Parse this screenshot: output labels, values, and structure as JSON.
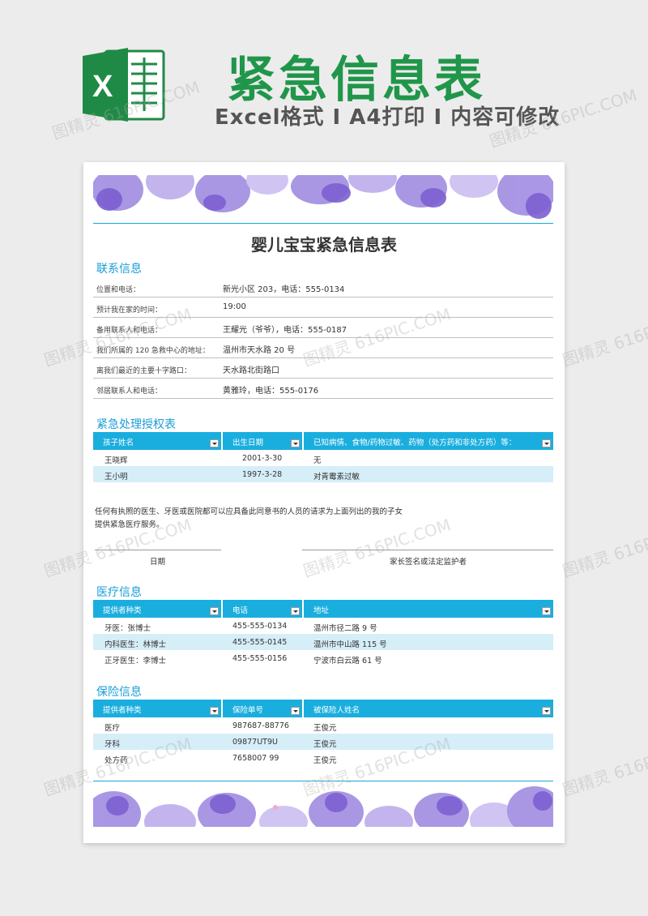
{
  "header": {
    "logo_letter": "X",
    "title": "紧急信息表",
    "subtitle": "Excel格式 I A4打印 I 内容可修改"
  },
  "watermark": "图精灵 616PIC.COM",
  "document": {
    "title": "婴儿宝宝紧急信息表",
    "contact_section": {
      "title": "联系信息",
      "rows": [
        {
          "label": "位置和电话：",
          "value": "新光小区 203，电话：555-0134"
        },
        {
          "label": "预计我在家的时间：",
          "value": "19:00"
        },
        {
          "label": "备用联系人和电话：",
          "value": "王耀光（爷爷），电话：555-0187"
        },
        {
          "label": "我们所属的 120 急救中心的地址：",
          "value": "温州市天水路 20 号"
        },
        {
          "label": "离我们最近的主要十字路口：",
          "value": "天水路北街路口"
        },
        {
          "label": "邻居联系人和电话：",
          "value": "黄雅玲，电话：555-0176"
        }
      ]
    },
    "authorization_section": {
      "title": "紧急处理授权表",
      "headers": [
        "孩子姓名",
        "出生日期",
        "已知病情、食物/药物过敏、药物（处方药和非处方药）等："
      ],
      "rows": [
        [
          "王晓辉",
          "2001-3-30",
          "无"
        ],
        [
          "王小明",
          "1997-3-28",
          "对青霉素过敏"
        ]
      ],
      "consent_line1": "任何有执照的医生、牙医或医院都可以应具备此同意书的人员的请求为上面列出的我的子女",
      "consent_line2": "提供紧急医疗服务。",
      "date_label": "日期",
      "signature_label": "家长签名或法定监护者"
    },
    "medical_section": {
      "title": "医疗信息",
      "headers": [
        "提供者种类",
        "电话",
        "地址"
      ],
      "rows": [
        [
          "牙医：张博士",
          "455-555-0134",
          "温州市径二路 9 号"
        ],
        [
          "内科医生：林博士",
          "455-555-0145",
          "温州市中山路 115 号"
        ],
        [
          "正牙医生：李博士",
          "455-555-0156",
          "宁波市白云路 61 号"
        ]
      ]
    },
    "insurance_section": {
      "title": "保险信息",
      "headers": [
        "提供者种类",
        "保险单号",
        "被保险人姓名"
      ],
      "rows": [
        [
          "医疗",
          "987687-88776",
          "王俊元"
        ],
        [
          "牙科",
          "09877UT9U",
          "王俊元"
        ],
        [
          "处方药",
          "7658007 99",
          "王俊元"
        ]
      ]
    }
  },
  "colors": {
    "brand_green": "#20964a",
    "accent_blue": "#1aaedf",
    "row_alt": "#d6eef8",
    "flower_purple": "#8a6fd6"
  }
}
